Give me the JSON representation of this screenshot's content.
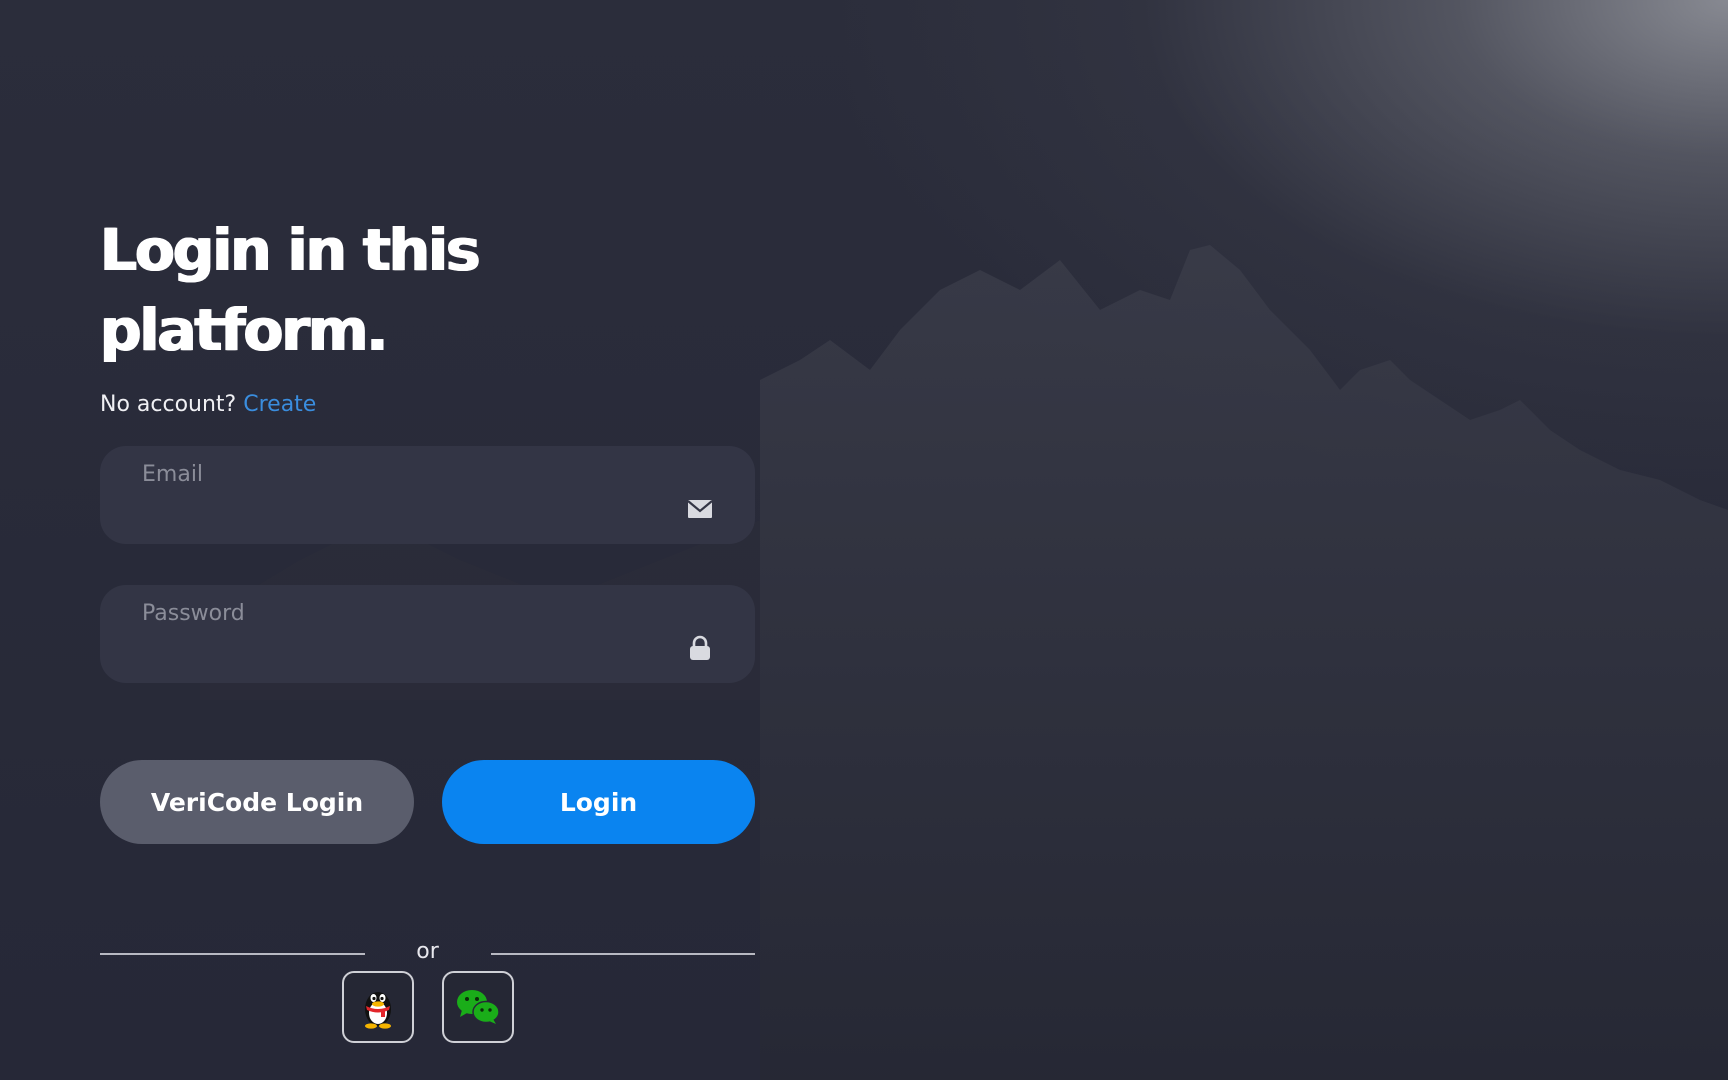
{
  "login": {
    "title": "Login in this platform.",
    "no_account_text": "No account?",
    "create_link": "Create",
    "email": {
      "label": "Email",
      "value": "",
      "icon": "mail-icon"
    },
    "password": {
      "label": "Password",
      "value": "",
      "icon": "lock-icon"
    },
    "vericode_button": "VeriCode Login",
    "login_button": "Login",
    "divider_text": "or",
    "social": [
      {
        "name": "QQ",
        "icon": "qq-penguin-icon"
      },
      {
        "name": "WeChat",
        "icon": "wechat-icon"
      }
    ]
  },
  "colors": {
    "background": "#262837",
    "field_background": "#343646",
    "primary_button": "#0a84f0",
    "secondary_button": "#5a5d6c",
    "link": "#3a8dde",
    "wechat_green": "#1aad19"
  }
}
